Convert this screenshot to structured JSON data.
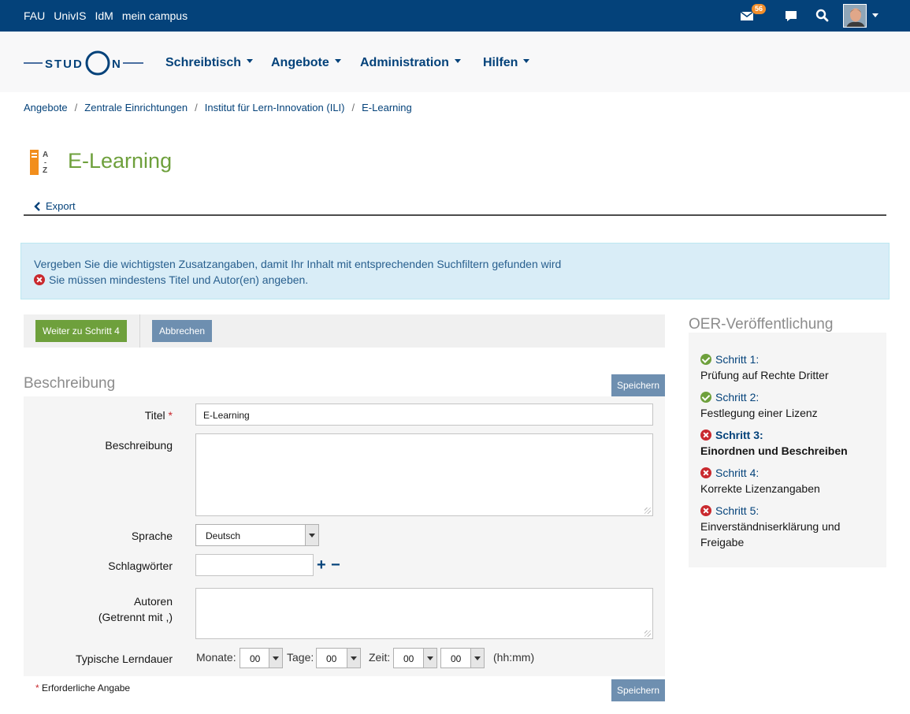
{
  "topbar": {
    "links": [
      "FAU",
      "UnivIS",
      "IdM",
      "mein campus"
    ],
    "mail_count": "56",
    "icons": [
      "mail-icon",
      "chat-icon",
      "search-icon",
      "avatar",
      "chevron-down-icon"
    ]
  },
  "nav": {
    "logo_text": "STUDON",
    "items": [
      {
        "label": "Schreibtisch"
      },
      {
        "label": "Angebote"
      },
      {
        "label": "Administration"
      },
      {
        "label": "Hilfen"
      }
    ]
  },
  "breadcrumb": [
    "Angebote",
    "Zentrale Einrichtungen",
    "Institut für Lern-Innovation (ILI)",
    "E-Learning"
  ],
  "header": {
    "title": "E-Learning",
    "icon_letters": [
      "A",
      "-",
      "Z"
    ]
  },
  "back": {
    "label": "Export"
  },
  "alert": {
    "info": "Vergeben Sie die wichtigsten Zusatzangaben, damit Ihr Inhalt mit entsprechenden Suchfiltern gefunden wird",
    "error": "Sie müssen mindestens Titel und Autor(en) angeben."
  },
  "toolbar": {
    "next_label": "Weiter zu Schritt 4",
    "cancel_label": "Abbrechen"
  },
  "form": {
    "title": "Beschreibung",
    "save_label": "Speichern",
    "fields": {
      "titel": {
        "label": "Titel",
        "required": "*",
        "value": "E-Learning"
      },
      "beschreibung": {
        "label": "Beschreibung",
        "value": ""
      },
      "sprache": {
        "label": "Sprache",
        "value": "Deutsch"
      },
      "schlagwoerter": {
        "label": "Schlagwörter",
        "value": "",
        "add": "+",
        "remove": "−"
      },
      "autoren": {
        "label_line1": "Autoren",
        "label_line2": "(Getrennt mit ,)",
        "value": ""
      },
      "lerndauer": {
        "label": "Typische Lerndauer",
        "monate_label": "Monate:",
        "monate": "00",
        "tage_label": "Tage:",
        "tage": "00",
        "zeit_label": "Zeit:",
        "stunden": "00",
        "minuten": "00",
        "format": "(hh:mm)"
      }
    },
    "required_note_star": "*",
    "required_note": "Erforderliche Angabe"
  },
  "sidepanel": {
    "title": "OER-Veröffentlichung",
    "steps": [
      {
        "title": "Schritt 1:",
        "desc": "Prüfung auf Rechte Dritter",
        "status": "done"
      },
      {
        "title": "Schritt 2:",
        "desc": "Festlegung einer Lizenz",
        "status": "done"
      },
      {
        "title": "Schritt 3:",
        "desc": "Einordnen und Beschreiben",
        "status": "current"
      },
      {
        "title": "Schritt 4:",
        "desc": "Korrekte Lizenzangaben",
        "status": "open"
      },
      {
        "title": "Schritt 5:",
        "desc_line1": "Einverständniserklärung und",
        "desc_line2": "Freigabe",
        "status": "open"
      }
    ]
  },
  "colors": {
    "topbar": "#04427a",
    "title_green": "#6ea03c",
    "button_blue": "#6e8fb0",
    "error_red": "#c9292e",
    "alert_bg": "#d9edf7"
  }
}
